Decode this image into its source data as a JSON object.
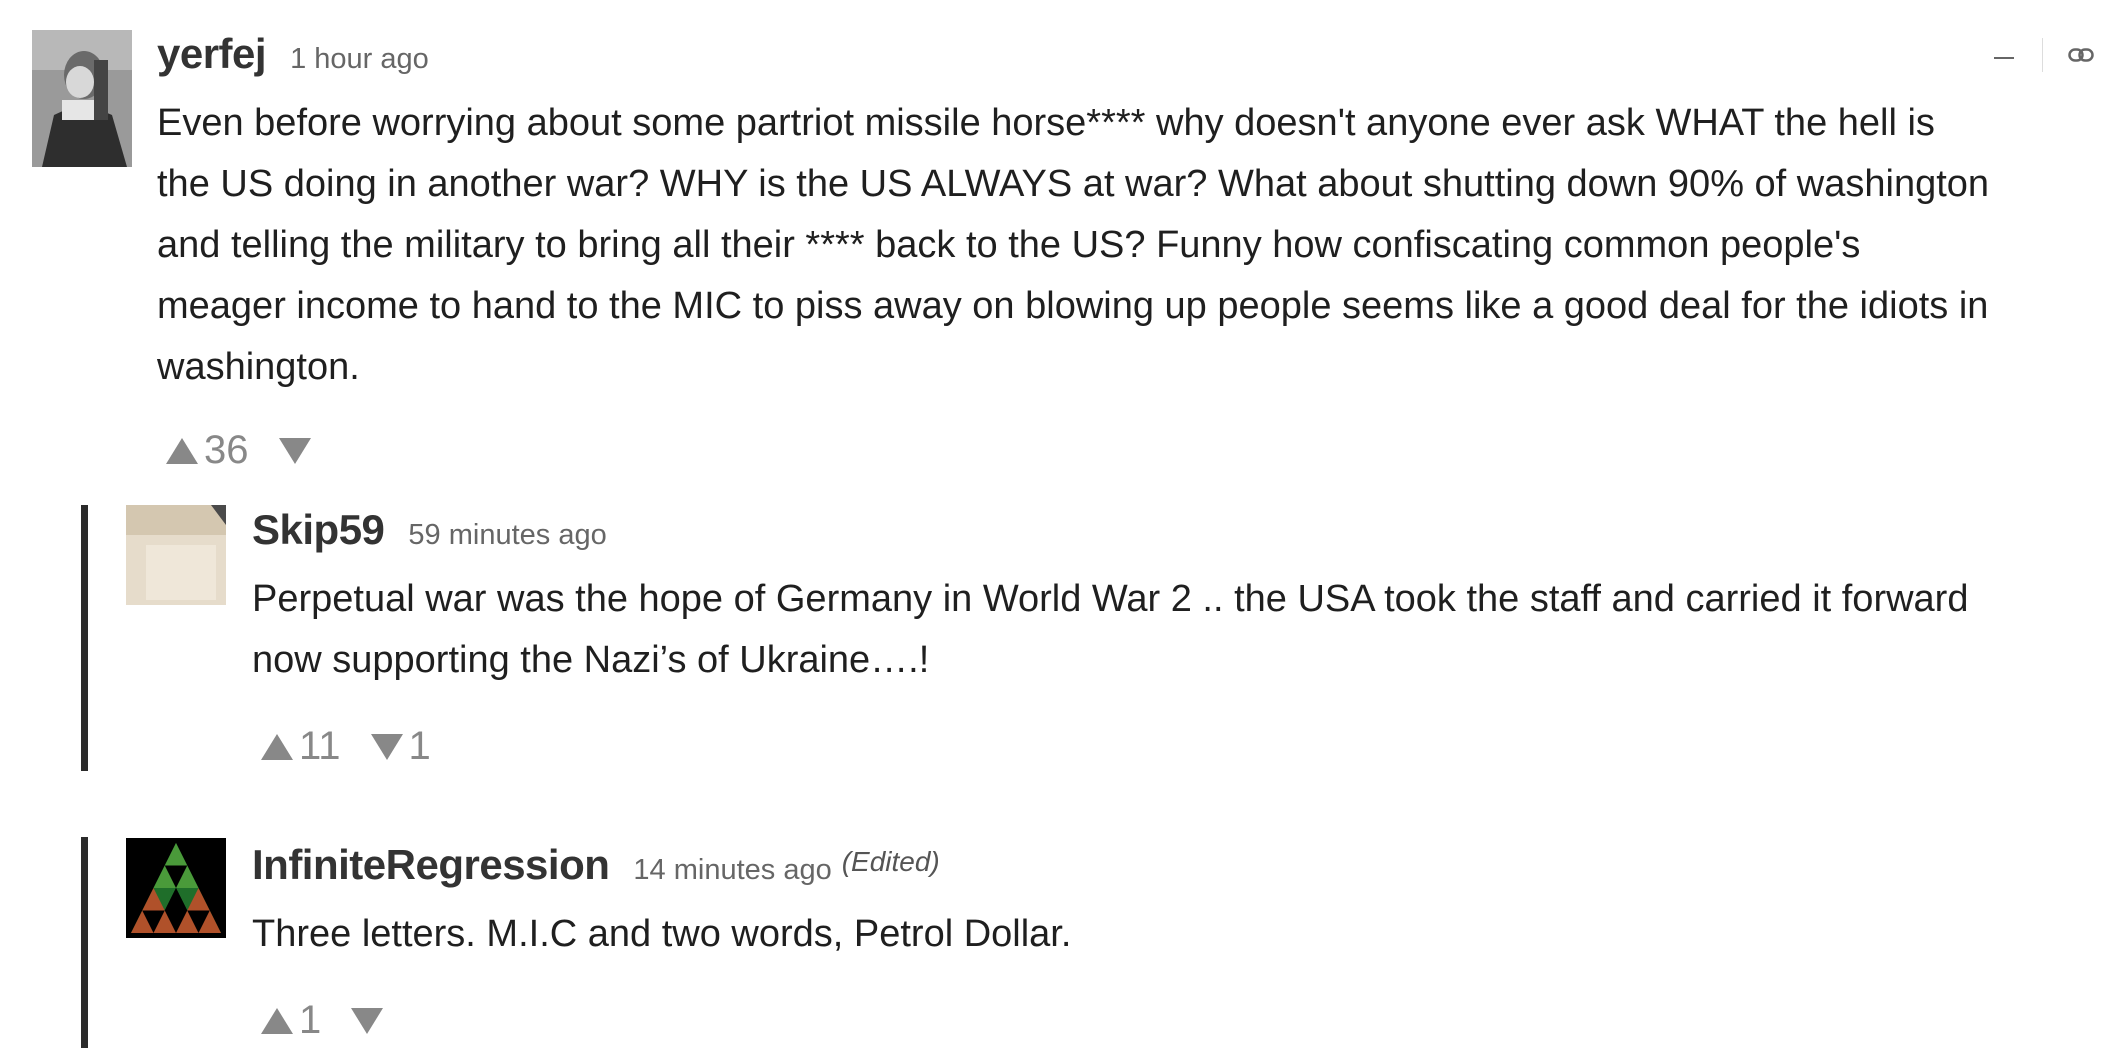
{
  "comments": [
    {
      "username": "yerfej",
      "timestamp": "1 hour ago",
      "body_lines": [
        "Even before worrying about some partriot missile horse**** why doesn't anyone ever ask WHAT the hell is",
        "the US doing in another war? WHY is the US ALWAYS at war? What about shutting down 90% of washington",
        "and telling the military to bring all their **** back to the US? Funny how confiscating common people's",
        "meager income to hand to the MIC to piss away on blowing up people seems like a good deal for the idiots in",
        "washington."
      ],
      "upvotes": "36",
      "downvotes": ""
    },
    {
      "username": "Skip59",
      "timestamp": "59 minutes ago",
      "body_lines": [
        "Perpetual war was the hope of Germany in World War 2 .. the USA took the staff and carried it forward",
        "now supporting the Nazi’s of Ukraine….!"
      ],
      "upvotes": "11",
      "downvotes": "1"
    },
    {
      "username": "InfiniteRegression",
      "timestamp": "14 minutes ago",
      "edited": "(Edited)",
      "body_lines": [
        "Three letters. M.I.C and two words, Petrol Dollar."
      ],
      "upvotes": "1",
      "downvotes": ""
    }
  ],
  "icons": {
    "collapse": "minus-icon",
    "permalink": "link-icon",
    "upvote": "triangle-up-icon",
    "downvote": "triangle-down-icon"
  },
  "colors": {
    "thread_bar": "#2b2b2b",
    "vote_gray": "#888888"
  }
}
